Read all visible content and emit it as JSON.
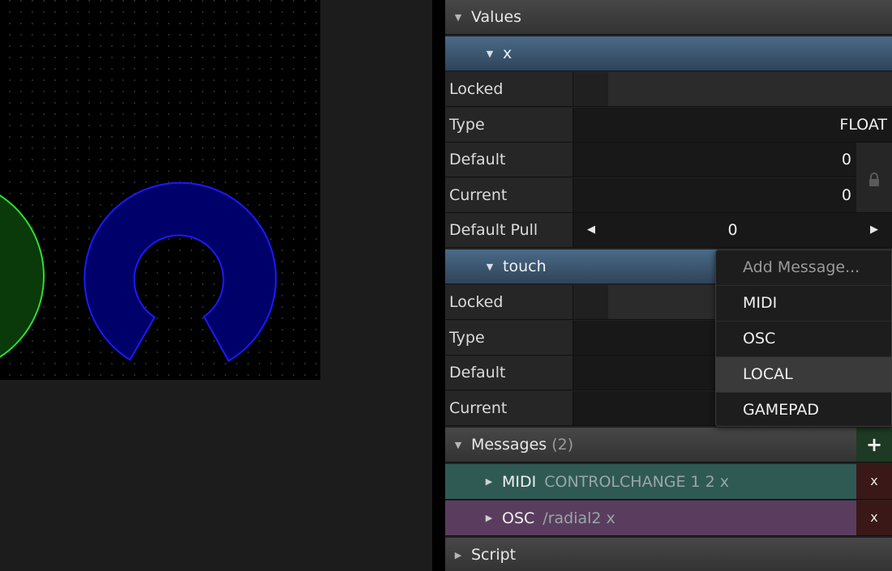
{
  "values_section": {
    "title": "Values"
  },
  "value_x": {
    "name": "x",
    "locked_label": "Locked",
    "type_label": "Type",
    "type_value": "FLOAT",
    "default_label": "Default",
    "default_value": "0",
    "current_label": "Current",
    "current_value": "0",
    "pull_label": "Default Pull",
    "pull_value": "0"
  },
  "value_touch": {
    "name": "touch",
    "locked_label": "Locked",
    "type_label": "Type",
    "default_label": "Default",
    "current_label": "Current"
  },
  "messages_section": {
    "title": "Messages",
    "count": "(2)",
    "add_label": "+"
  },
  "messages": [
    {
      "kind": "MIDI",
      "detail": "CONTROLCHANGE 1 2 x",
      "color": "#2f5a54",
      "delete_label": "x"
    },
    {
      "kind": "OSC",
      "detail": "/radial2 x",
      "color": "#5a3d5e",
      "delete_label": "x"
    }
  ],
  "script_section": {
    "title": "Script"
  },
  "dropdown": {
    "header": "Add Message...",
    "options": [
      "MIDI",
      "OSC",
      "LOCAL",
      "GAMEPAD"
    ],
    "hovered": "LOCAL"
  },
  "colors": {
    "canvas_bg": "#000000",
    "green_widget": "#2ee02e",
    "blue_widget": "#1a1aff",
    "value_header": "#3d5670",
    "add_button": "#1f3a24",
    "delete_button": "#3a1818"
  },
  "icons": {
    "expanded": "triangle-down",
    "collapsed": "triangle-right",
    "lock": "lock-icon",
    "decrement": "arrow-left",
    "increment": "arrow-right"
  }
}
